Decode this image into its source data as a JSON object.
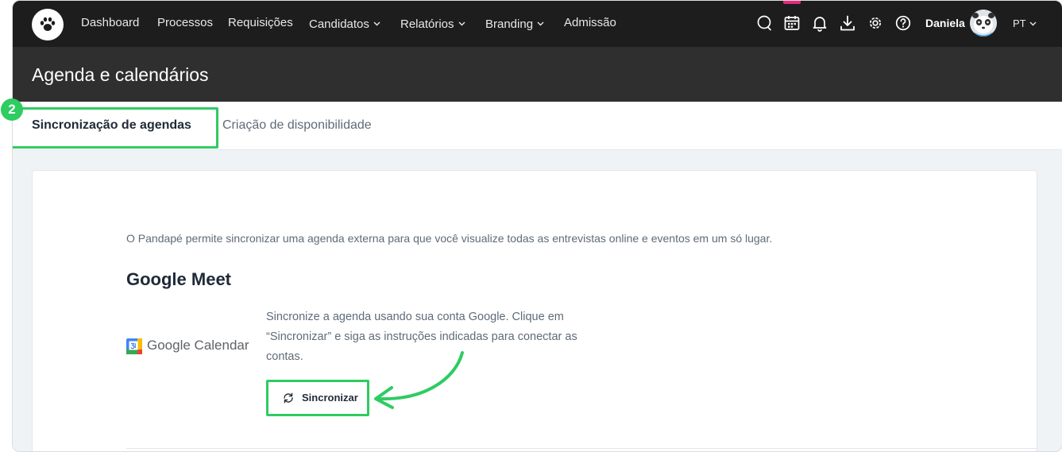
{
  "nav": {
    "items": [
      {
        "label": "Dashboard"
      },
      {
        "label": "Processos"
      },
      {
        "label": "Requisições"
      },
      {
        "label": "Candidatos"
      },
      {
        "label": "Relatórios"
      },
      {
        "label": "Branding"
      },
      {
        "label": "Admissão"
      }
    ],
    "icons": [
      "chat-icon",
      "calendar-icon",
      "bell-icon",
      "download-icon",
      "gear-icon",
      "help-icon"
    ],
    "user_name": "Daniela",
    "language": "PT"
  },
  "header": {
    "title": "Agenda e calendários"
  },
  "tabs": [
    {
      "label": "Sincronização de agendas",
      "active": true
    },
    {
      "label": "Criação de disponibilidade",
      "active": false
    }
  ],
  "step_badge": "2",
  "content": {
    "intro": "O Pandapé permite sincronizar uma agenda externa para que você visualize todas as entrevistas online e eventos em um só lugar.",
    "section_title": "Google Meet",
    "provider_name": "Google Calendar",
    "description": "Sincronize a agenda usando sua conta Google. Clique em “Sincronizar” e siga as instruções indicadas para conectar as contas.",
    "sync_button": "Sincronizar"
  },
  "colors": {
    "nav_bg": "#1d1d1d",
    "header_bg": "#2f2f2f",
    "highlight": "#2ecc61",
    "calendar_marker": "#e6297a"
  }
}
